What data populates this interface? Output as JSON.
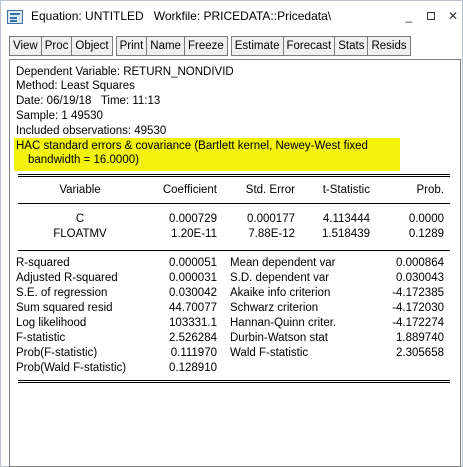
{
  "window": {
    "title": "Equation: UNTITLED   Workfile: PRICEDATA::Pricedata\\",
    "min_glyph": "_",
    "close_glyph": "✕"
  },
  "toolbar": {
    "group1": [
      "View",
      "Proc",
      "Object"
    ],
    "group2": [
      "Print",
      "Name",
      "Freeze"
    ],
    "group3": [
      "Estimate",
      "Forecast",
      "Stats",
      "Resids"
    ]
  },
  "header": {
    "dependent": "Dependent Variable: RETURN_NONDIVID",
    "method": "Method: Least Squares",
    "date": "Date: 06/19/18   Time: 11:13",
    "sample": "Sample: 1 49530",
    "included": "Included observations: 49530",
    "hac_line1": "HAC standard errors & covariance (Bartlett kernel, Newey-West fixed",
    "hac_line2": "bandwidth = 16.0000)",
    "highlight_color": "#f2f20a"
  },
  "coef_table": {
    "columns": [
      "Variable",
      "Coefficient",
      "Std. Error",
      "t-Statistic",
      "Prob."
    ],
    "rows": [
      [
        "C",
        "0.000729",
        "0.000177",
        "4.113444",
        "0.0000"
      ],
      [
        "FLOATMV",
        "1.20E-11",
        "7.88E-12",
        "1.518439",
        "0.1289"
      ]
    ]
  },
  "stats": {
    "left": [
      [
        "R-squared",
        "0.000051"
      ],
      [
        "Adjusted R-squared",
        "0.000031"
      ],
      [
        "S.E. of regression",
        "0.030042"
      ],
      [
        "Sum squared resid",
        "44.70077"
      ],
      [
        "Log likelihood",
        "103331.1"
      ],
      [
        "F-statistic",
        "2.526284"
      ],
      [
        "Prob(F-statistic)",
        "0.111970"
      ],
      [
        "Prob(Wald F-statistic)",
        "0.128910"
      ]
    ],
    "right": [
      [
        "Mean dependent var",
        "0.000864"
      ],
      [
        "S.D. dependent var",
        "0.030043"
      ],
      [
        "Akaike info criterion",
        "-4.172385"
      ],
      [
        "Schwarz criterion",
        "-4.172030"
      ],
      [
        "Hannan-Quinn criter.",
        "-4.172274"
      ],
      [
        "Durbin-Watson stat",
        "1.889740"
      ],
      [
        "Wald F-statistic",
        "2.305658"
      ]
    ]
  }
}
